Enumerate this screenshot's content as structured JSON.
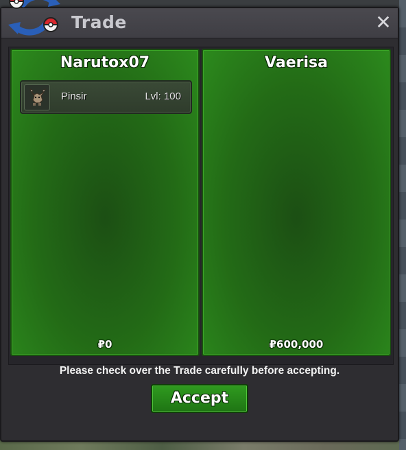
{
  "window": {
    "title": "Trade",
    "close_icon": "close-icon"
  },
  "left_offer": {
    "player": "Narutox07",
    "items": [
      {
        "name": "Pinsir",
        "level": "Lvl: 100",
        "icon": "pinsir-sprite-icon"
      }
    ],
    "money": "₽0"
  },
  "right_offer": {
    "player": "Vaerisa",
    "items": [],
    "money": "₽600,000"
  },
  "notice": "Please check over the Trade carefully before accepting.",
  "accept_label": "Accept",
  "colors": {
    "panel_green": "#236b16",
    "button_green": "#2f9a1f",
    "window": "#2e2d31"
  }
}
